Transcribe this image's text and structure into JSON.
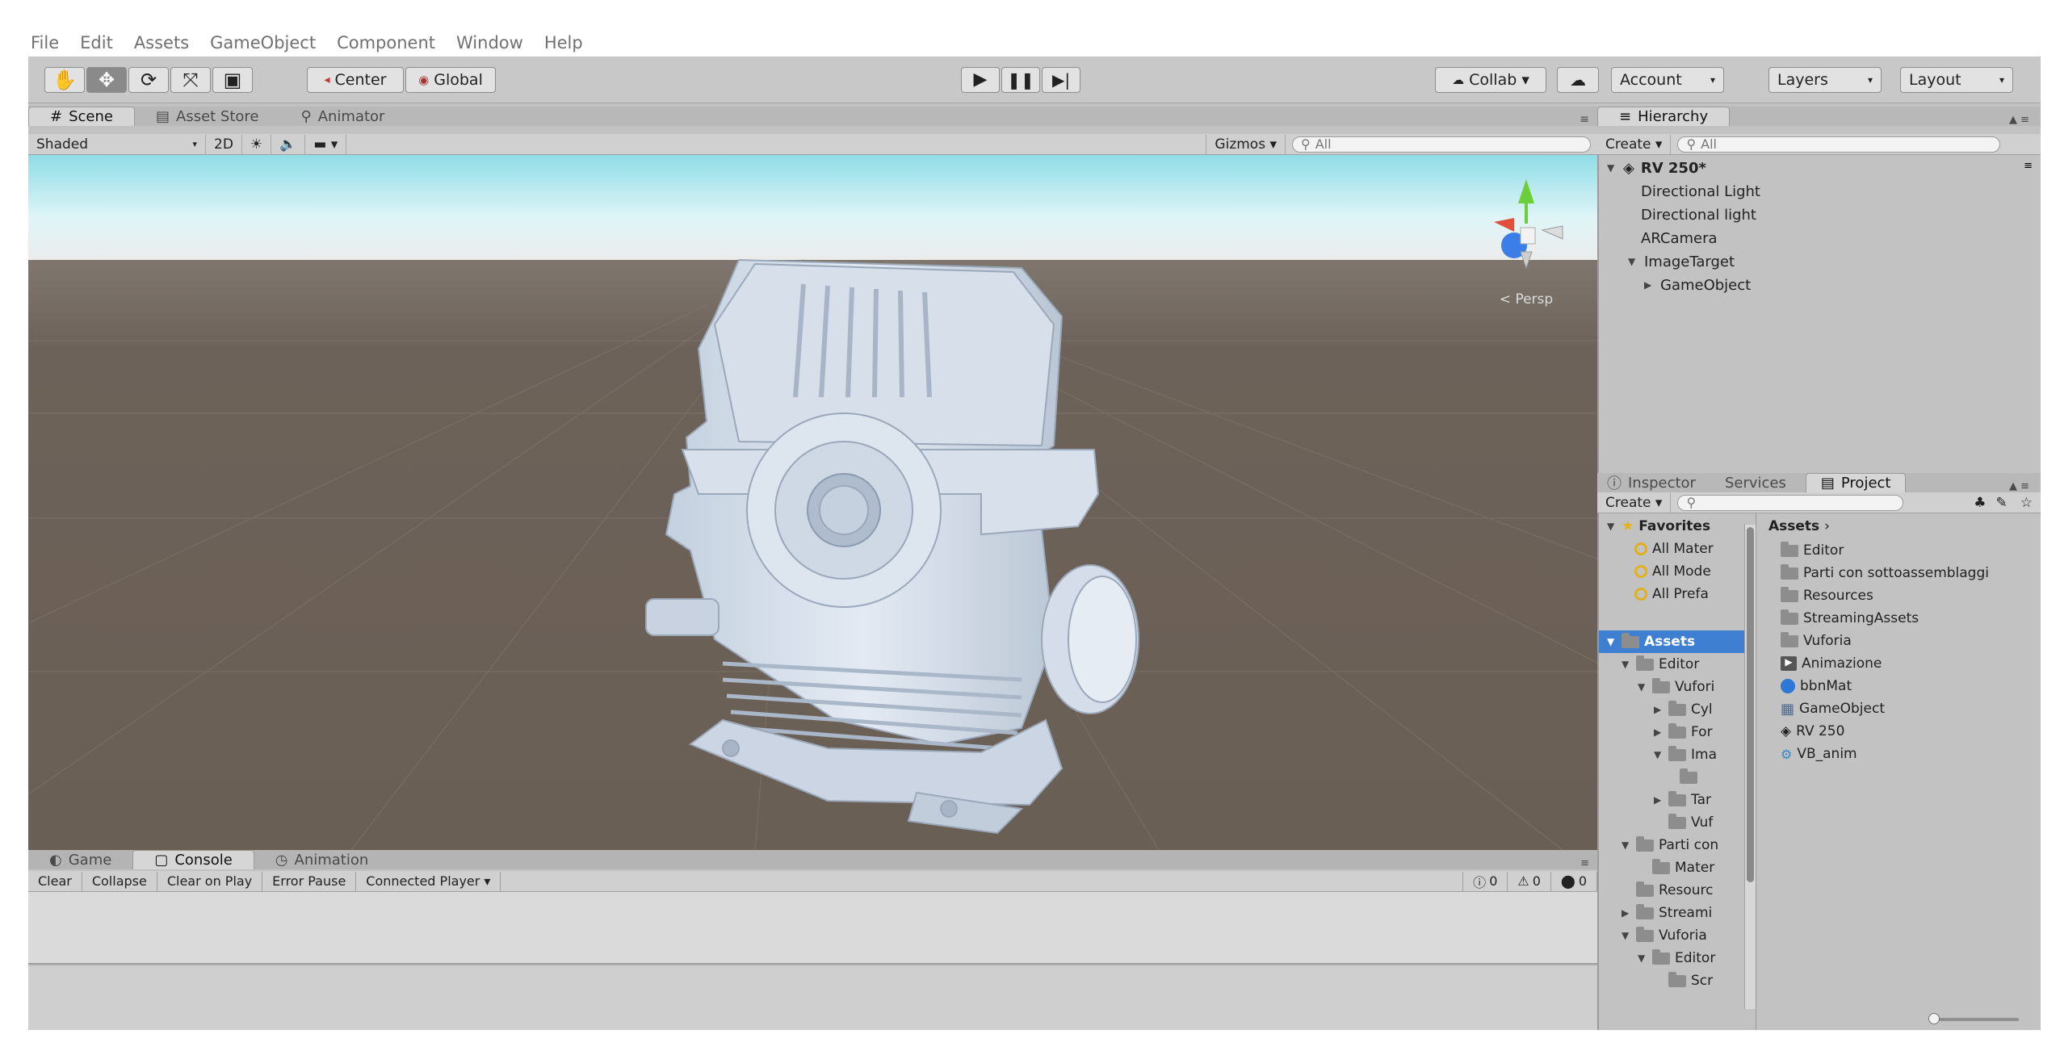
{
  "menu": [
    "File",
    "Edit",
    "Assets",
    "GameObject",
    "Component",
    "Window",
    "Help"
  ],
  "toolbar": {
    "pivot_label": "Center",
    "space_label": "Global",
    "collab_label": "Collab ▾",
    "account_label": "Account",
    "layers_label": "Layers",
    "layout_label": "Layout"
  },
  "scene_tabs": [
    "Scene",
    "Asset Store",
    "Animator"
  ],
  "scene_bar": {
    "shading": "Shaded",
    "mode_2d": "2D",
    "gizmos": "Gizmos ▾",
    "search_placeholder": "All"
  },
  "gizmo": {
    "projection": "< Persp"
  },
  "hierarchy": {
    "tab": "Hierarchy",
    "create": "Create ▾",
    "search_placeholder": "All",
    "scene_name": "RV 250*",
    "items": [
      {
        "label": "Directional Light",
        "depth": 1
      },
      {
        "label": "Directional light",
        "depth": 1
      },
      {
        "label": "ARCamera",
        "depth": 1
      },
      {
        "label": "ImageTarget",
        "depth": 1,
        "expanded": true
      },
      {
        "label": "GameObject",
        "depth": 2,
        "collapsed": true
      }
    ]
  },
  "project_tabs": [
    "Inspector",
    "Services",
    "Project"
  ],
  "project": {
    "create": "Create ▾",
    "favorites_label": "Favorites",
    "favorites": [
      "All Mater",
      "All Mode",
      "All Prefa"
    ],
    "assets_header": "Assets",
    "tree": [
      {
        "label": "Assets",
        "depth": 0,
        "selected": true
      },
      {
        "label": "Editor",
        "depth": 1
      },
      {
        "label": "Vufori",
        "depth": 2
      },
      {
        "label": "Cyl",
        "depth": 3
      },
      {
        "label": "For",
        "depth": 3
      },
      {
        "label": "Ima",
        "depth": 3
      },
      {
        "label": "",
        "depth": 4
      },
      {
        "label": "Tar",
        "depth": 3
      },
      {
        "label": "Vuf",
        "depth": 3
      },
      {
        "label": "Parti con",
        "depth": 1
      },
      {
        "label": "Mater",
        "depth": 2
      },
      {
        "label": "Resourc",
        "depth": 1
      },
      {
        "label": "Streami",
        "depth": 1
      },
      {
        "label": "Vuforia",
        "depth": 1
      },
      {
        "label": "Editor",
        "depth": 2
      },
      {
        "label": "Scr",
        "depth": 3
      }
    ],
    "assets": [
      {
        "label": "Editor",
        "icon": "folder-icon"
      },
      {
        "label": "Parti con sottoassemblaggi",
        "icon": "folder-icon"
      },
      {
        "label": "Resources",
        "icon": "folder-icon"
      },
      {
        "label": "StreamingAssets",
        "icon": "folder-icon"
      },
      {
        "label": "Vuforia",
        "icon": "folder-icon"
      },
      {
        "label": "Animazione",
        "icon": "animation-icon"
      },
      {
        "label": "bbnMat",
        "icon": "material-icon"
      },
      {
        "label": "GameObject",
        "icon": "prefab-icon"
      },
      {
        "label": "RV 250",
        "icon": "scene-icon"
      },
      {
        "label": "VB_anim",
        "icon": "controller-icon"
      }
    ]
  },
  "console_tabs": [
    "Game",
    "Console",
    "Animation"
  ],
  "console_bar": [
    "Clear",
    "Collapse",
    "Clear on Play",
    "Error Pause",
    "Connected Player ▾"
  ],
  "console_counts": [
    "0",
    "0",
    "0"
  ],
  "colors": {
    "sky": "#bfe9ef",
    "ground": "#6a5f55",
    "model": "#cdd8e6",
    "selection": "#3e7fd1"
  }
}
